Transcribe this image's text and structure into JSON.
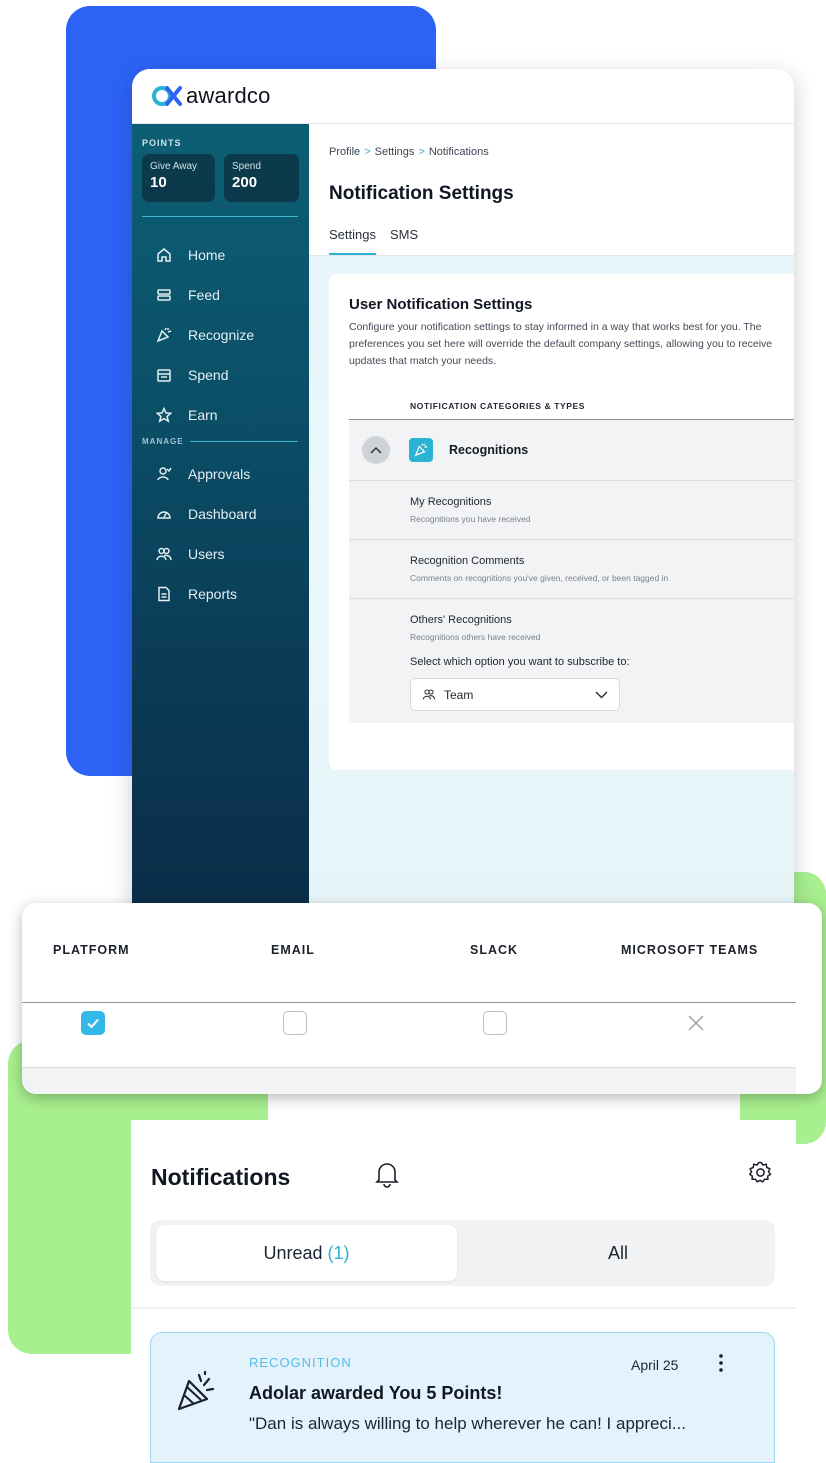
{
  "brand": {
    "name": "awardco",
    "accent": "#2ab3d3",
    "primary_blue": "#2d63f5",
    "green": "#a8f08f",
    "sidebar_dark": "#0b3a55"
  },
  "sidebar": {
    "points_label": "POINTS",
    "give_away": {
      "label": "Give Away",
      "value": "10"
    },
    "spend": {
      "label": "Spend",
      "value": "200"
    },
    "nav_items": [
      {
        "label": "Home",
        "icon": "home-icon"
      },
      {
        "label": "Feed",
        "icon": "feed-icon"
      },
      {
        "label": "Recognize",
        "icon": "party-popper-icon"
      },
      {
        "label": "Spend",
        "icon": "store-icon"
      },
      {
        "label": "Earn",
        "icon": "star-icon"
      }
    ],
    "manage_label": "MANAGE",
    "manage_items": [
      {
        "label": "Approvals",
        "icon": "approval-icon"
      },
      {
        "label": "Dashboard",
        "icon": "gauge-icon"
      },
      {
        "label": "Users",
        "icon": "users-icon"
      },
      {
        "label": "Reports",
        "icon": "document-icon"
      }
    ]
  },
  "header": {
    "breadcrumb": [
      "Profile",
      "Settings",
      "Notifications"
    ],
    "breadcrumb_sep": ">",
    "title": "Notification Settings",
    "tabs": [
      {
        "label": "Settings",
        "active": true
      },
      {
        "label": "SMS",
        "active": false
      }
    ]
  },
  "settings_card": {
    "title": "User Notification Settings",
    "description": "Configure your notification settings to stay informed in a way that works best for you. The preferences you set here will override the default company settings, allowing you to receive updates that match your needs.",
    "column_header": "NOTIFICATION CATEGORIES & TYPES",
    "category": "Recognitions",
    "types": [
      {
        "name": "My Recognitions",
        "description": "Recognitions you have received"
      },
      {
        "name": "Recognition Comments",
        "description": "Comments on recognitions you've given, received, or been tagged in"
      },
      {
        "name": "Others' Recognitions",
        "description": "Recognitions others have received"
      }
    ],
    "subscribe_label": "Select which option you want to subscribe to:",
    "subscribe_value": "Team"
  },
  "channels": {
    "columns": [
      "PLATFORM",
      "EMAIL",
      "SLACK",
      "MICROSOFT TEAMS"
    ],
    "platform_checked": true,
    "email_checked": false,
    "slack_checked": false,
    "microsoft_teams": "unavailable"
  },
  "notifications": {
    "title": "Notifications",
    "tabs": {
      "unread_label": "Unread",
      "unread_count": "(1)",
      "all_label": "All"
    },
    "item": {
      "category": "RECOGNITION",
      "date": "April 25",
      "headline": "Adolar awarded You 5 Points!",
      "body": "\"Dan is always willing to help wherever he can! I appreci..."
    }
  }
}
